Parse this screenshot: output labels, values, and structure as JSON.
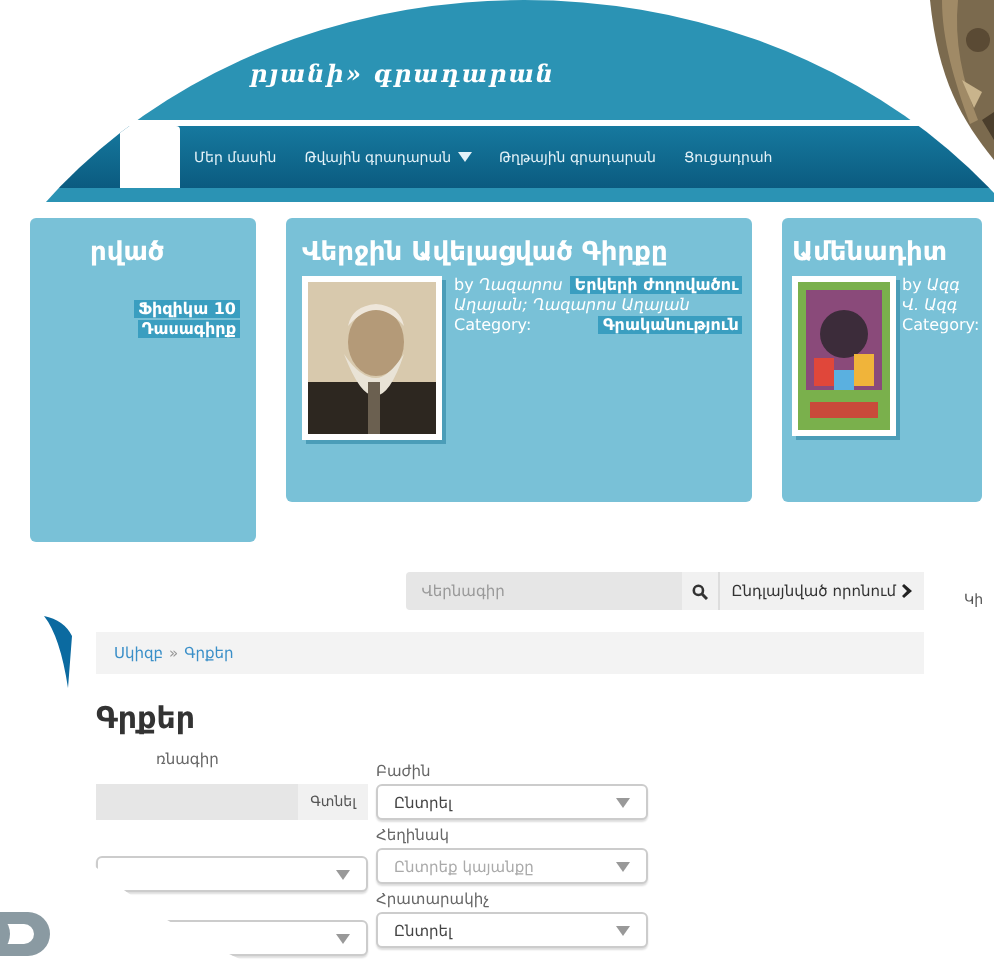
{
  "site_title": "րյանի» գրադարան",
  "nav": [
    {
      "selected": true,
      "dropdown": false
    },
    {
      "label": "Մեր մասին",
      "selected": false,
      "dropdown": false
    },
    {
      "label": "Թվային գրադարան",
      "selected": false,
      "dropdown": true
    },
    {
      "label": "Թղթային գրադարան",
      "selected": false,
      "dropdown": false
    },
    {
      "label": "Ցուցադրահ",
      "selected": false,
      "dropdown": false
    }
  ],
  "cards": [
    {
      "title": "րված",
      "has_picture": false,
      "rows": [
        {
          "tag": "Ֆիզիկա 10"
        },
        {
          "tag": "Դասագիրք"
        }
      ]
    },
    {
      "title": "Վերջին Ավելացված Գիրքը",
      "has_picture": true,
      "rows": [
        {
          "text": "by *Ղազարոս*",
          "tag": "Երկերի ժողովածու"
        },
        {
          "text": "Աղայան; Ղազարոս Աղայան",
          "italic": true
        },
        {
          "text": "Category:",
          "tag": "Գրականություն"
        }
      ]
    },
    {
      "title": "Ամենադիտ",
      "has_picture": true,
      "rows": [
        {
          "text": "by *Ազգ*"
        },
        {
          "text": "Վ. Ազգ",
          "italic": true
        },
        {
          "text": "Category:"
        }
      ]
    }
  ],
  "search": {
    "placeholder": "Վերնագիր",
    "advanced_label": "Ընդլայնված որոնում"
  },
  "breadcrumb": {
    "items": [
      "Սկիզբ",
      "Գրքեր"
    ],
    "separator": "»"
  },
  "heading": "Գրքեր",
  "filters": {
    "left": {
      "label": "ռնագիր",
      "button": "Գտնել",
      "selects": [
        {
          "kind": "select"
        },
        {
          "kind": "select"
        }
      ]
    },
    "right": [
      {
        "label": "Բաժին",
        "value": "Ընտրել"
      },
      {
        "label": "Հեղինակ",
        "placeholder": "Ընտրեք կայանքը"
      },
      {
        "label": "Հրատարակիչ",
        "value": "Ընտրել"
      }
    ]
  },
  "side_peek": "Կի"
}
